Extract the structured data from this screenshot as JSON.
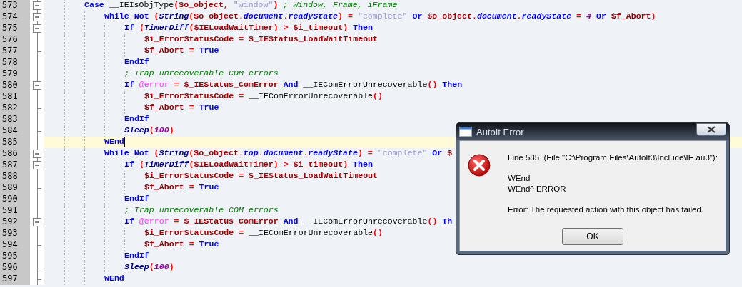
{
  "editor": {
    "lines": [
      {
        "number": "573",
        "expanded": true,
        "tokens": [
          {
            "kind": "kw",
            "text": "Case "
          },
          {
            "kind": "plain",
            "text": "__IEIsObjType"
          },
          {
            "kind": "op",
            "text": "("
          },
          {
            "kind": "var",
            "text": "$o_object"
          },
          {
            "kind": "op",
            "text": ", "
          },
          {
            "kind": "str",
            "text": "\"window\""
          },
          {
            "kind": "op",
            "text": ")"
          },
          {
            "kind": "cmt",
            "text": " ; Window, Frame, iFrame"
          }
        ],
        "children": [
          {
            "number": "574",
            "expanded": true,
            "tokens": [
              {
                "kind": "kw",
                "text": "While Not "
              },
              {
                "kind": "op",
                "text": "("
              },
              {
                "kind": "fn",
                "text": "String"
              },
              {
                "kind": "op",
                "text": "("
              },
              {
                "kind": "var",
                "text": "$o_object"
              },
              {
                "kind": "op",
                "text": "."
              },
              {
                "kind": "prop",
                "text": "document"
              },
              {
                "kind": "op",
                "text": "."
              },
              {
                "kind": "prop",
                "text": "readyState"
              },
              {
                "kind": "op",
                "text": ") = "
              },
              {
                "kind": "str",
                "text": "\"complete\""
              },
              {
                "kind": "kw",
                "text": " Or "
              },
              {
                "kind": "var",
                "text": "$o_object"
              },
              {
                "kind": "op",
                "text": "."
              },
              {
                "kind": "prop",
                "text": "document"
              },
              {
                "kind": "op",
                "text": "."
              },
              {
                "kind": "prop",
                "text": "readyState"
              },
              {
                "kind": "op",
                "text": " = "
              },
              {
                "kind": "num",
                "text": "4"
              },
              {
                "kind": "kw",
                "text": " Or "
              },
              {
                "kind": "var",
                "text": "$f_Abort"
              },
              {
                "kind": "op",
                "text": ")"
              }
            ],
            "children": [
              {
                "number": "575",
                "expanded": true,
                "tokens": [
                  {
                    "kind": "kw",
                    "text": "If "
                  },
                  {
                    "kind": "op",
                    "text": "("
                  },
                  {
                    "kind": "fn",
                    "text": "TimerDiff"
                  },
                  {
                    "kind": "op",
                    "text": "("
                  },
                  {
                    "kind": "var",
                    "text": "$IELoadWaitTimer"
                  },
                  {
                    "kind": "op",
                    "text": ") > "
                  },
                  {
                    "kind": "var",
                    "text": "$i_timeout"
                  },
                  {
                    "kind": "op",
                    "text": ")"
                  },
                  {
                    "kind": "kw",
                    "text": " Then"
                  }
                ],
                "children": [
                  {
                    "number": "576",
                    "tokens": [
                      {
                        "kind": "var",
                        "text": "$i_ErrorStatusCode"
                      },
                      {
                        "kind": "op",
                        "text": " = "
                      },
                      {
                        "kind": "var",
                        "text": "$_IEStatus_LoadWaitTimeout"
                      }
                    ]
                  },
                  {
                    "number": "577",
                    "tokens": [
                      {
                        "kind": "var",
                        "text": "$f_Abort"
                      },
                      {
                        "kind": "op",
                        "text": " = "
                      },
                      {
                        "kind": "kw",
                        "text": "True"
                      }
                    ]
                  }
                ]
              },
              {
                "number": "578",
                "tokens": [
                  {
                    "kind": "kw",
                    "text": "EndIf"
                  }
                ]
              },
              {
                "number": "579",
                "tokens": [
                  {
                    "kind": "cmt",
                    "text": "; Trap unrecoverable COM errors"
                  }
                ]
              },
              {
                "number": "580",
                "expanded": true,
                "tokens": [
                  {
                    "kind": "kw",
                    "text": "If "
                  },
                  {
                    "kind": "macro",
                    "text": "@error"
                  },
                  {
                    "kind": "op",
                    "text": " = "
                  },
                  {
                    "kind": "var",
                    "text": "$_IEStatus_ComError"
                  },
                  {
                    "kind": "kw",
                    "text": " And "
                  },
                  {
                    "kind": "plain",
                    "text": "__IEComErrorUnrecoverable"
                  },
                  {
                    "kind": "op",
                    "text": "()"
                  },
                  {
                    "kind": "kw",
                    "text": " Then"
                  }
                ],
                "children": [
                  {
                    "number": "581",
                    "tokens": [
                      {
                        "kind": "var",
                        "text": "$i_ErrorStatusCode"
                      },
                      {
                        "kind": "op",
                        "text": " = "
                      },
                      {
                        "kind": "plain",
                        "text": "__IEComErrorUnrecoverable"
                      },
                      {
                        "kind": "op",
                        "text": "()"
                      }
                    ]
                  },
                  {
                    "number": "582",
                    "tokens": [
                      {
                        "kind": "var",
                        "text": "$f_Abort"
                      },
                      {
                        "kind": "op",
                        "text": " = "
                      },
                      {
                        "kind": "kw",
                        "text": "True"
                      }
                    ]
                  }
                ]
              },
              {
                "number": "583",
                "tokens": [
                  {
                    "kind": "kw",
                    "text": "EndIf"
                  }
                ]
              },
              {
                "number": "584",
                "tokens": [
                  {
                    "kind": "fn",
                    "text": "Sleep"
                  },
                  {
                    "kind": "op",
                    "text": "("
                  },
                  {
                    "kind": "num",
                    "text": "100"
                  },
                  {
                    "kind": "op",
                    "text": ")"
                  }
                ]
              }
            ]
          },
          {
            "number": "585",
            "current": true,
            "tokens": [
              {
                "kind": "kw",
                "text": "WEnd"
              }
            ]
          },
          {
            "number": "586",
            "expanded": true,
            "tokens": [
              {
                "kind": "kw",
                "text": "While Not "
              },
              {
                "kind": "op",
                "text": "("
              },
              {
                "kind": "fn",
                "text": "String"
              },
              {
                "kind": "op",
                "text": "("
              },
              {
                "kind": "var",
                "text": "$o_object"
              },
              {
                "kind": "op",
                "text": "."
              },
              {
                "kind": "prop",
                "text": "top"
              },
              {
                "kind": "op",
                "text": "."
              },
              {
                "kind": "prop",
                "text": "document"
              },
              {
                "kind": "op",
                "text": "."
              },
              {
                "kind": "prop",
                "text": "readyState"
              },
              {
                "kind": "op",
                "text": ") = "
              },
              {
                "kind": "str",
                "text": "\"complete\""
              },
              {
                "kind": "kw",
                "text": " Or "
              },
              {
                "kind": "var",
                "text": "$"
              }
            ],
            "children": [
              {
                "number": "587",
                "expanded": true,
                "tokens": [
                  {
                    "kind": "kw",
                    "text": "If "
                  },
                  {
                    "kind": "op",
                    "text": "("
                  },
                  {
                    "kind": "fn",
                    "text": "TimerDiff"
                  },
                  {
                    "kind": "op",
                    "text": "("
                  },
                  {
                    "kind": "var",
                    "text": "$IELoadWaitTimer"
                  },
                  {
                    "kind": "op",
                    "text": ") > "
                  },
                  {
                    "kind": "var",
                    "text": "$i_timeout"
                  },
                  {
                    "kind": "op",
                    "text": ")"
                  },
                  {
                    "kind": "kw",
                    "text": " Then"
                  }
                ],
                "children": [
                  {
                    "number": "588",
                    "tokens": [
                      {
                        "kind": "var",
                        "text": "$i_ErrorStatusCode"
                      },
                      {
                        "kind": "op",
                        "text": " = "
                      },
                      {
                        "kind": "var",
                        "text": "$_IEStatus_LoadWaitTimeout"
                      }
                    ]
                  },
                  {
                    "number": "589",
                    "tokens": [
                      {
                        "kind": "var",
                        "text": "$f_Abort"
                      },
                      {
                        "kind": "op",
                        "text": " = "
                      },
                      {
                        "kind": "kw",
                        "text": "True"
                      }
                    ]
                  }
                ]
              },
              {
                "number": "590",
                "tokens": [
                  {
                    "kind": "kw",
                    "text": "EndIf"
                  }
                ]
              },
              {
                "number": "591",
                "tokens": [
                  {
                    "kind": "cmt",
                    "text": "; Trap unrecoverable COM errors"
                  }
                ]
              },
              {
                "number": "592",
                "expanded": true,
                "tokens": [
                  {
                    "kind": "kw",
                    "text": "If "
                  },
                  {
                    "kind": "macro",
                    "text": "@error"
                  },
                  {
                    "kind": "op",
                    "text": " = "
                  },
                  {
                    "kind": "var",
                    "text": "$_IEStatus_ComError"
                  },
                  {
                    "kind": "kw",
                    "text": " And "
                  },
                  {
                    "kind": "plain",
                    "text": "__IEComErrorUnrecoverable"
                  },
                  {
                    "kind": "op",
                    "text": "()"
                  },
                  {
                    "kind": "kw",
                    "text": " Th"
                  }
                ],
                "children": [
                  {
                    "number": "593",
                    "tokens": [
                      {
                        "kind": "var",
                        "text": "$i_ErrorStatusCode"
                      },
                      {
                        "kind": "op",
                        "text": " = "
                      },
                      {
                        "kind": "plain",
                        "text": "__IEComErrorUnrecoverable"
                      },
                      {
                        "kind": "op",
                        "text": "()"
                      }
                    ]
                  },
                  {
                    "number": "594",
                    "tokens": [
                      {
                        "kind": "var",
                        "text": "$f_Abort"
                      },
                      {
                        "kind": "op",
                        "text": " = "
                      },
                      {
                        "kind": "kw",
                        "text": "True"
                      }
                    ]
                  }
                ]
              },
              {
                "number": "595",
                "tokens": [
                  {
                    "kind": "kw",
                    "text": "EndIf"
                  }
                ]
              },
              {
                "number": "596",
                "tokens": [
                  {
                    "kind": "fn",
                    "text": "Sleep"
                  },
                  {
                    "kind": "op",
                    "text": "("
                  },
                  {
                    "kind": "num",
                    "text": "100"
                  },
                  {
                    "kind": "op",
                    "text": ")"
                  }
                ]
              }
            ]
          },
          {
            "number": "597",
            "tokens": [
              {
                "kind": "kw",
                "text": "WEnd"
              }
            ]
          }
        ]
      }
    ]
  },
  "dialog": {
    "title": "AutoIt Error",
    "paragraphs": [
      [
        "Line 585  (File \"C:\\Program Files\\AutoIt3\\Include\\IE.au3\"):"
      ],
      [
        "WEnd",
        "WEnd^ ERROR"
      ],
      [
        "Error: The requested action with this object has failed."
      ]
    ],
    "button": "OK"
  }
}
